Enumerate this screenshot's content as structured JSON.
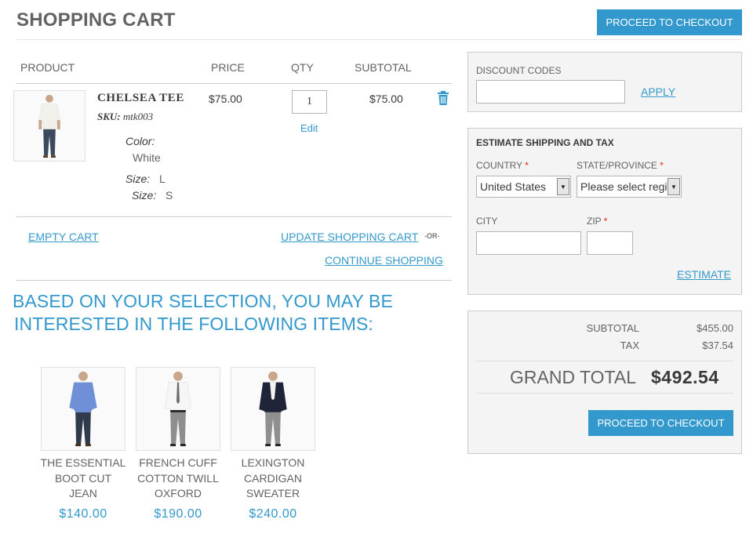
{
  "header": {
    "title": "SHOPPING CART",
    "checkout_label": "PROCEED TO CHECKOUT"
  },
  "cart": {
    "columns": {
      "product": "PRODUCT",
      "price": "PRICE",
      "qty": "QTY",
      "subtotal": "SUBTOTAL"
    },
    "items": [
      {
        "name": "CHELSEA TEE",
        "sku_label": "SKU:",
        "sku": "mtk003",
        "options": [
          {
            "label": "Color:",
            "value": "White"
          },
          {
            "label": "Size:",
            "value": "L"
          },
          {
            "label": "Size:",
            "value": "S"
          }
        ],
        "price": "$75.00",
        "qty": "1",
        "edit_label": "Edit",
        "subtotal": "$75.00",
        "delete_icon": "trash-icon"
      }
    ],
    "actions": {
      "empty": "EMPTY CART",
      "update": "UPDATE SHOPPING CART",
      "or": "-OR-",
      "continue": "CONTINUE SHOPPING"
    }
  },
  "crosssell": {
    "title_line1": "BASED ON YOUR SELECTION, YOU MAY BE",
    "title_line2": "INTERESTED IN THE FOLLOWING ITEMS:",
    "items": [
      {
        "name_lines": [
          "THE ESSENTIAL",
          "BOOT CUT",
          "JEAN"
        ],
        "price": "$140.00"
      },
      {
        "name_lines": [
          "FRENCH CUFF",
          "COTTON TWILL",
          "OXFORD"
        ],
        "price": "$190.00"
      },
      {
        "name_lines": [
          "LEXINGTON",
          "CARDIGAN",
          "SWEATER"
        ],
        "price": "$240.00"
      }
    ]
  },
  "discount": {
    "label": "DISCOUNT CODES",
    "value": "",
    "apply": "APPLY"
  },
  "shipping": {
    "heading": "ESTIMATE SHIPPING AND TAX",
    "country_label": "COUNTRY",
    "country_value": "United States",
    "state_label": "STATE/PROVINCE",
    "state_value": "Please select region",
    "city_label": "CITY",
    "zip_label": "ZIP",
    "required_mark": "*",
    "estimate": "ESTIMATE"
  },
  "totals": {
    "subtotal_label": "SUBTOTAL",
    "subtotal_value": "$455.00",
    "tax_label": "TAX",
    "tax_value": "$37.54",
    "grand_label": "GRAND TOTAL",
    "grand_value": "$492.54",
    "checkout_label": "PROCEED TO CHECKOUT"
  },
  "colors": {
    "accent": "#3399cc",
    "text": "#636363",
    "required": "#df280a"
  }
}
